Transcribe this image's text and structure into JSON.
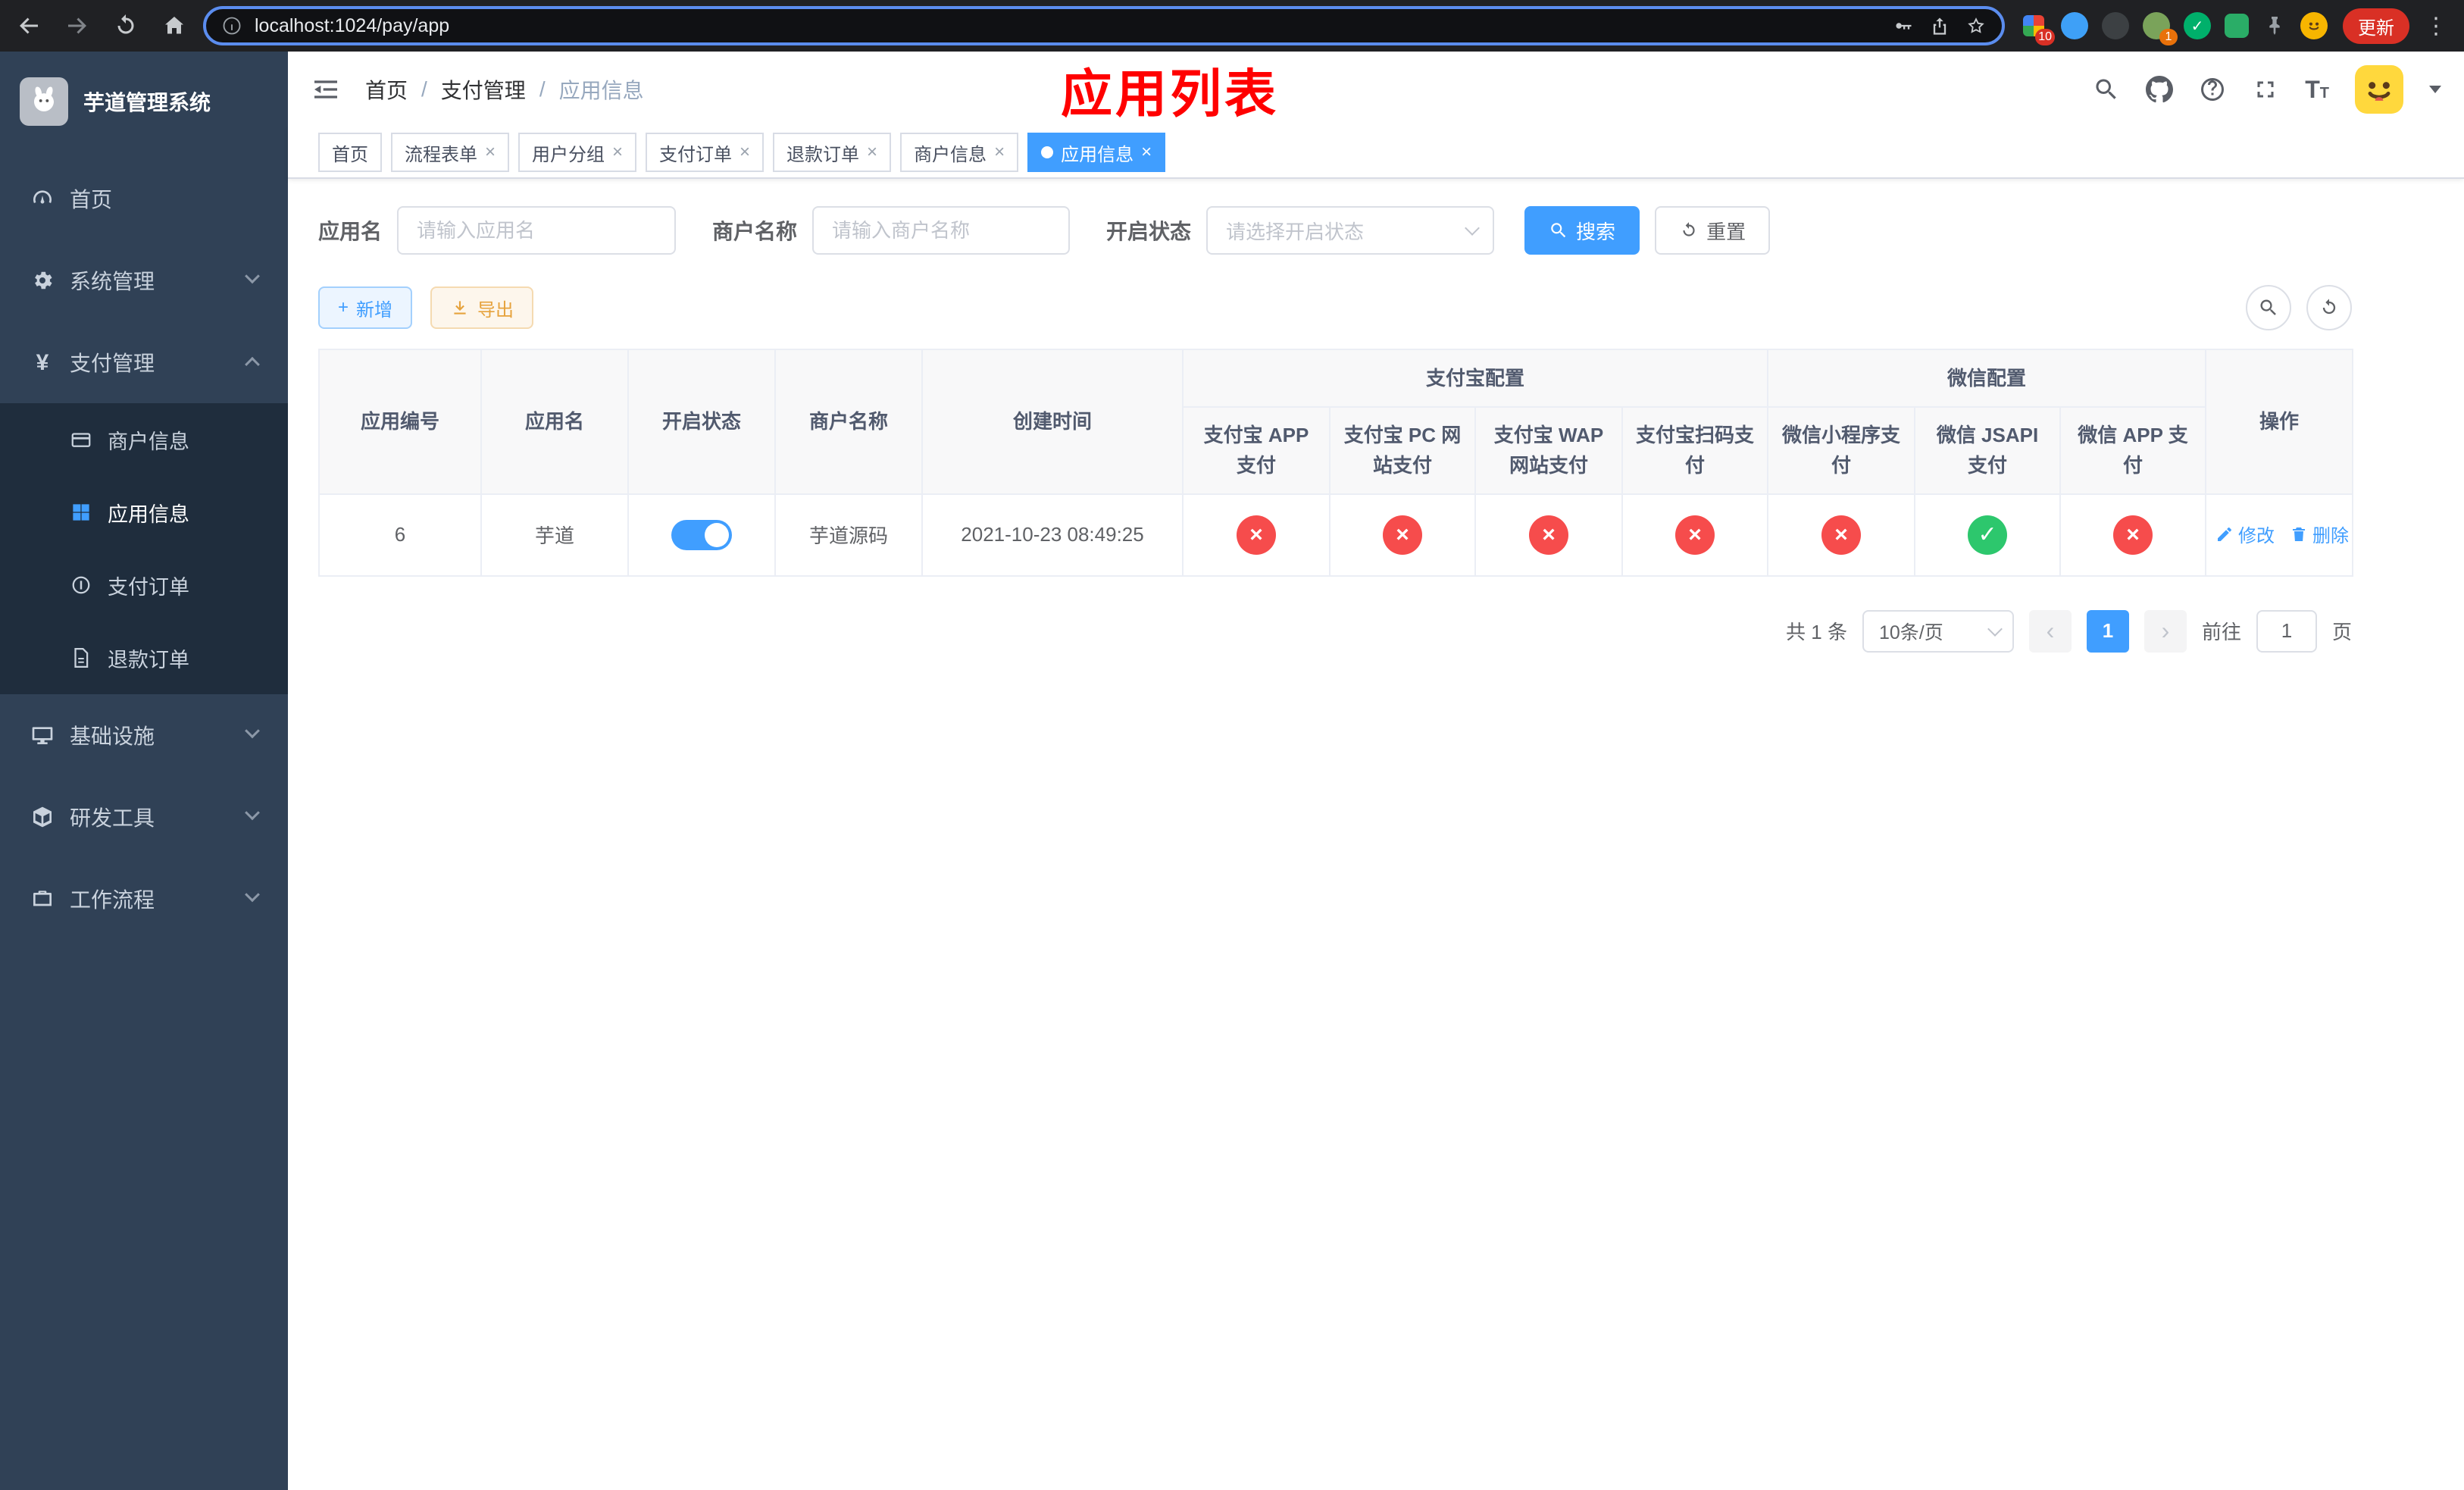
{
  "colors": {
    "primary": "#409eff",
    "danger": "#f64c4c",
    "success": "#2dc76d",
    "warning": "#e6a23c",
    "sidebar_bg": "#304156",
    "sidebar_submenu_bg": "#1f2d3d"
  },
  "browser": {
    "url": "localhost:1024/pay/app",
    "update_label": "更新",
    "extensions_badge": "10",
    "avatar_badge": "1"
  },
  "sidebar": {
    "title": "芋道管理系统",
    "menu": [
      {
        "label": "首页"
      },
      {
        "label": "系统管理"
      },
      {
        "label": "支付管理"
      },
      {
        "label": "商户信息"
      },
      {
        "label": "应用信息"
      },
      {
        "label": "支付订单"
      },
      {
        "label": "退款订单"
      },
      {
        "label": "基础设施"
      },
      {
        "label": "研发工具"
      },
      {
        "label": "工作流程"
      }
    ]
  },
  "header": {
    "breadcrumb": [
      "首页",
      "支付管理",
      "应用信息"
    ],
    "overlay_title": "应用列表"
  },
  "tabs": [
    {
      "label": "首页",
      "closable": false,
      "active": false
    },
    {
      "label": "流程表单",
      "closable": true,
      "active": false
    },
    {
      "label": "用户分组",
      "closable": true,
      "active": false
    },
    {
      "label": "支付订单",
      "closable": true,
      "active": false
    },
    {
      "label": "退款订单",
      "closable": true,
      "active": false
    },
    {
      "label": "商户信息",
      "closable": true,
      "active": false
    },
    {
      "label": "应用信息",
      "closable": true,
      "active": true
    }
  ],
  "filters": {
    "app_name_label": "应用名",
    "app_name_placeholder": "请输入应用名",
    "merchant_label": "商户名称",
    "merchant_placeholder": "请输入商户名称",
    "status_label": "开启状态",
    "status_placeholder": "请选择开启状态",
    "search_label": "搜索",
    "reset_label": "重置"
  },
  "toolbar": {
    "add_label": "新增",
    "export_label": "导出"
  },
  "table": {
    "group_headers": {
      "alipay": "支付宝配置",
      "wechat": "微信配置"
    },
    "columns": [
      "应用编号",
      "应用名",
      "开启状态",
      "商户名称",
      "创建时间",
      "支付宝 APP 支付",
      "支付宝 PC 网站支付",
      "支付宝 WAP 网站支付",
      "支付宝扫码支付",
      "微信小程序支付",
      "微信 JSAPI 支付",
      "微信 APP 支付",
      "操作"
    ],
    "rows": [
      {
        "id": "6",
        "name": "芋道",
        "enabled": true,
        "merchant": "芋道源码",
        "created": "2021-10-23 08:49:25",
        "alipay_app": false,
        "alipay_pc": false,
        "alipay_wap": false,
        "alipay_qr": false,
        "wechat_mini": false,
        "wechat_jsapi": true,
        "wechat_app": false,
        "edit_label": "修改",
        "delete_label": "删除"
      }
    ]
  },
  "pagination": {
    "total_label": "共 1 条",
    "page_size_label": "10条/页",
    "current_page": "1",
    "goto_label": "前往",
    "goto_value": "1",
    "page_suffix": "页"
  }
}
